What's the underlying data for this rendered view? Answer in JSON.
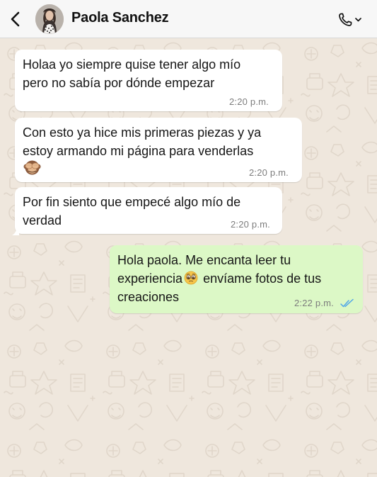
{
  "header": {
    "contact_name": "Paola Sanchez",
    "back_icon": "chevron-left-icon",
    "call_icon": "phone-icon"
  },
  "messages": [
    {
      "direction": "incoming",
      "text": "Holaa yo siempre quise tener algo mío\npero no sabía por dónde empezar",
      "time": "2:20 p.m."
    },
    {
      "direction": "incoming",
      "text": "Con esto ya hice mis primeras piezas y ya\nestoy armando mi página para venderlas",
      "emoji": "see-no-evil-monkey-emoji",
      "time": "2:20 p.m."
    },
    {
      "direction": "incoming",
      "text": "Por fin siento que empecé algo mío de\nverdad",
      "time": "2:20 p.m."
    },
    {
      "direction": "outgoing",
      "text_part1": "Hola paola. Me encanta leer tu\nexperiencia",
      "emoji": "pleading-face-emoji",
      "text_part2": " envíame fotos de tus\ncreaciones",
      "time": "2:22 p.m.",
      "status": "read"
    }
  ],
  "colors": {
    "incoming_bubble": "#ffffff",
    "outgoing_bubble": "#dcf8c6",
    "wallpaper": "#efe7dd",
    "read_ticks": "#4fa6e8"
  }
}
